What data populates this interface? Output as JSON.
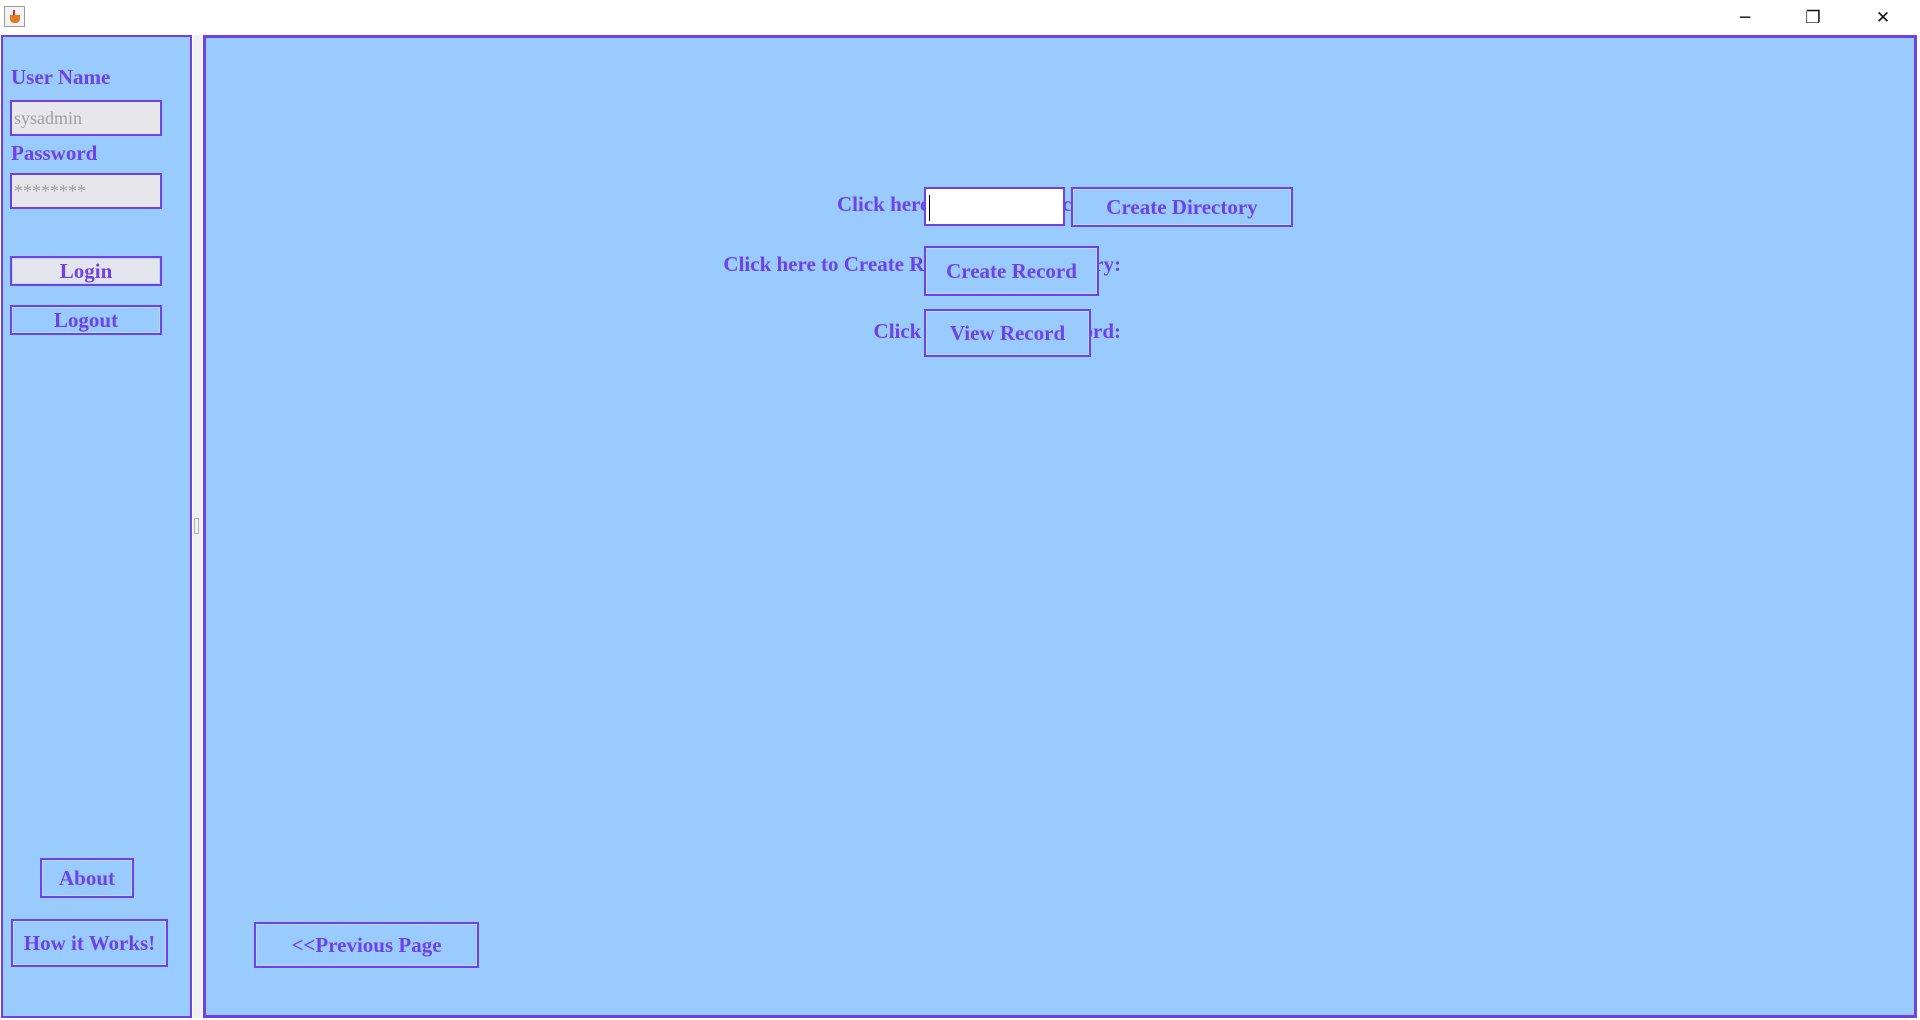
{
  "window": {
    "icon": "java-cup-icon",
    "controls": {
      "minimize": "─",
      "maximize": "❐",
      "close": "✕"
    }
  },
  "login_panel": {
    "username_label": "User Name",
    "username_value": "sysadmin",
    "password_label": "Password",
    "password_value": "********",
    "login_button": "Login",
    "logout_button": "Logout",
    "about_button": "About",
    "how_it_works_button": "How it Works!"
  },
  "main": {
    "create_directory_label": "Click here to Create Directory :",
    "create_directory_input": "",
    "create_directory_button": "Create Directory",
    "create_record_label": "Click here to Create Record of the Industry:",
    "create_record_button": "Create Record",
    "view_record_label": "Click here to View  Record:",
    "view_record_button": "View Record",
    "previous_page_button": "<<Previous Page"
  },
  "colors": {
    "panel_background": "#99cbfe",
    "accent": "#6f42e8",
    "field_background": "#e6e6eb"
  }
}
